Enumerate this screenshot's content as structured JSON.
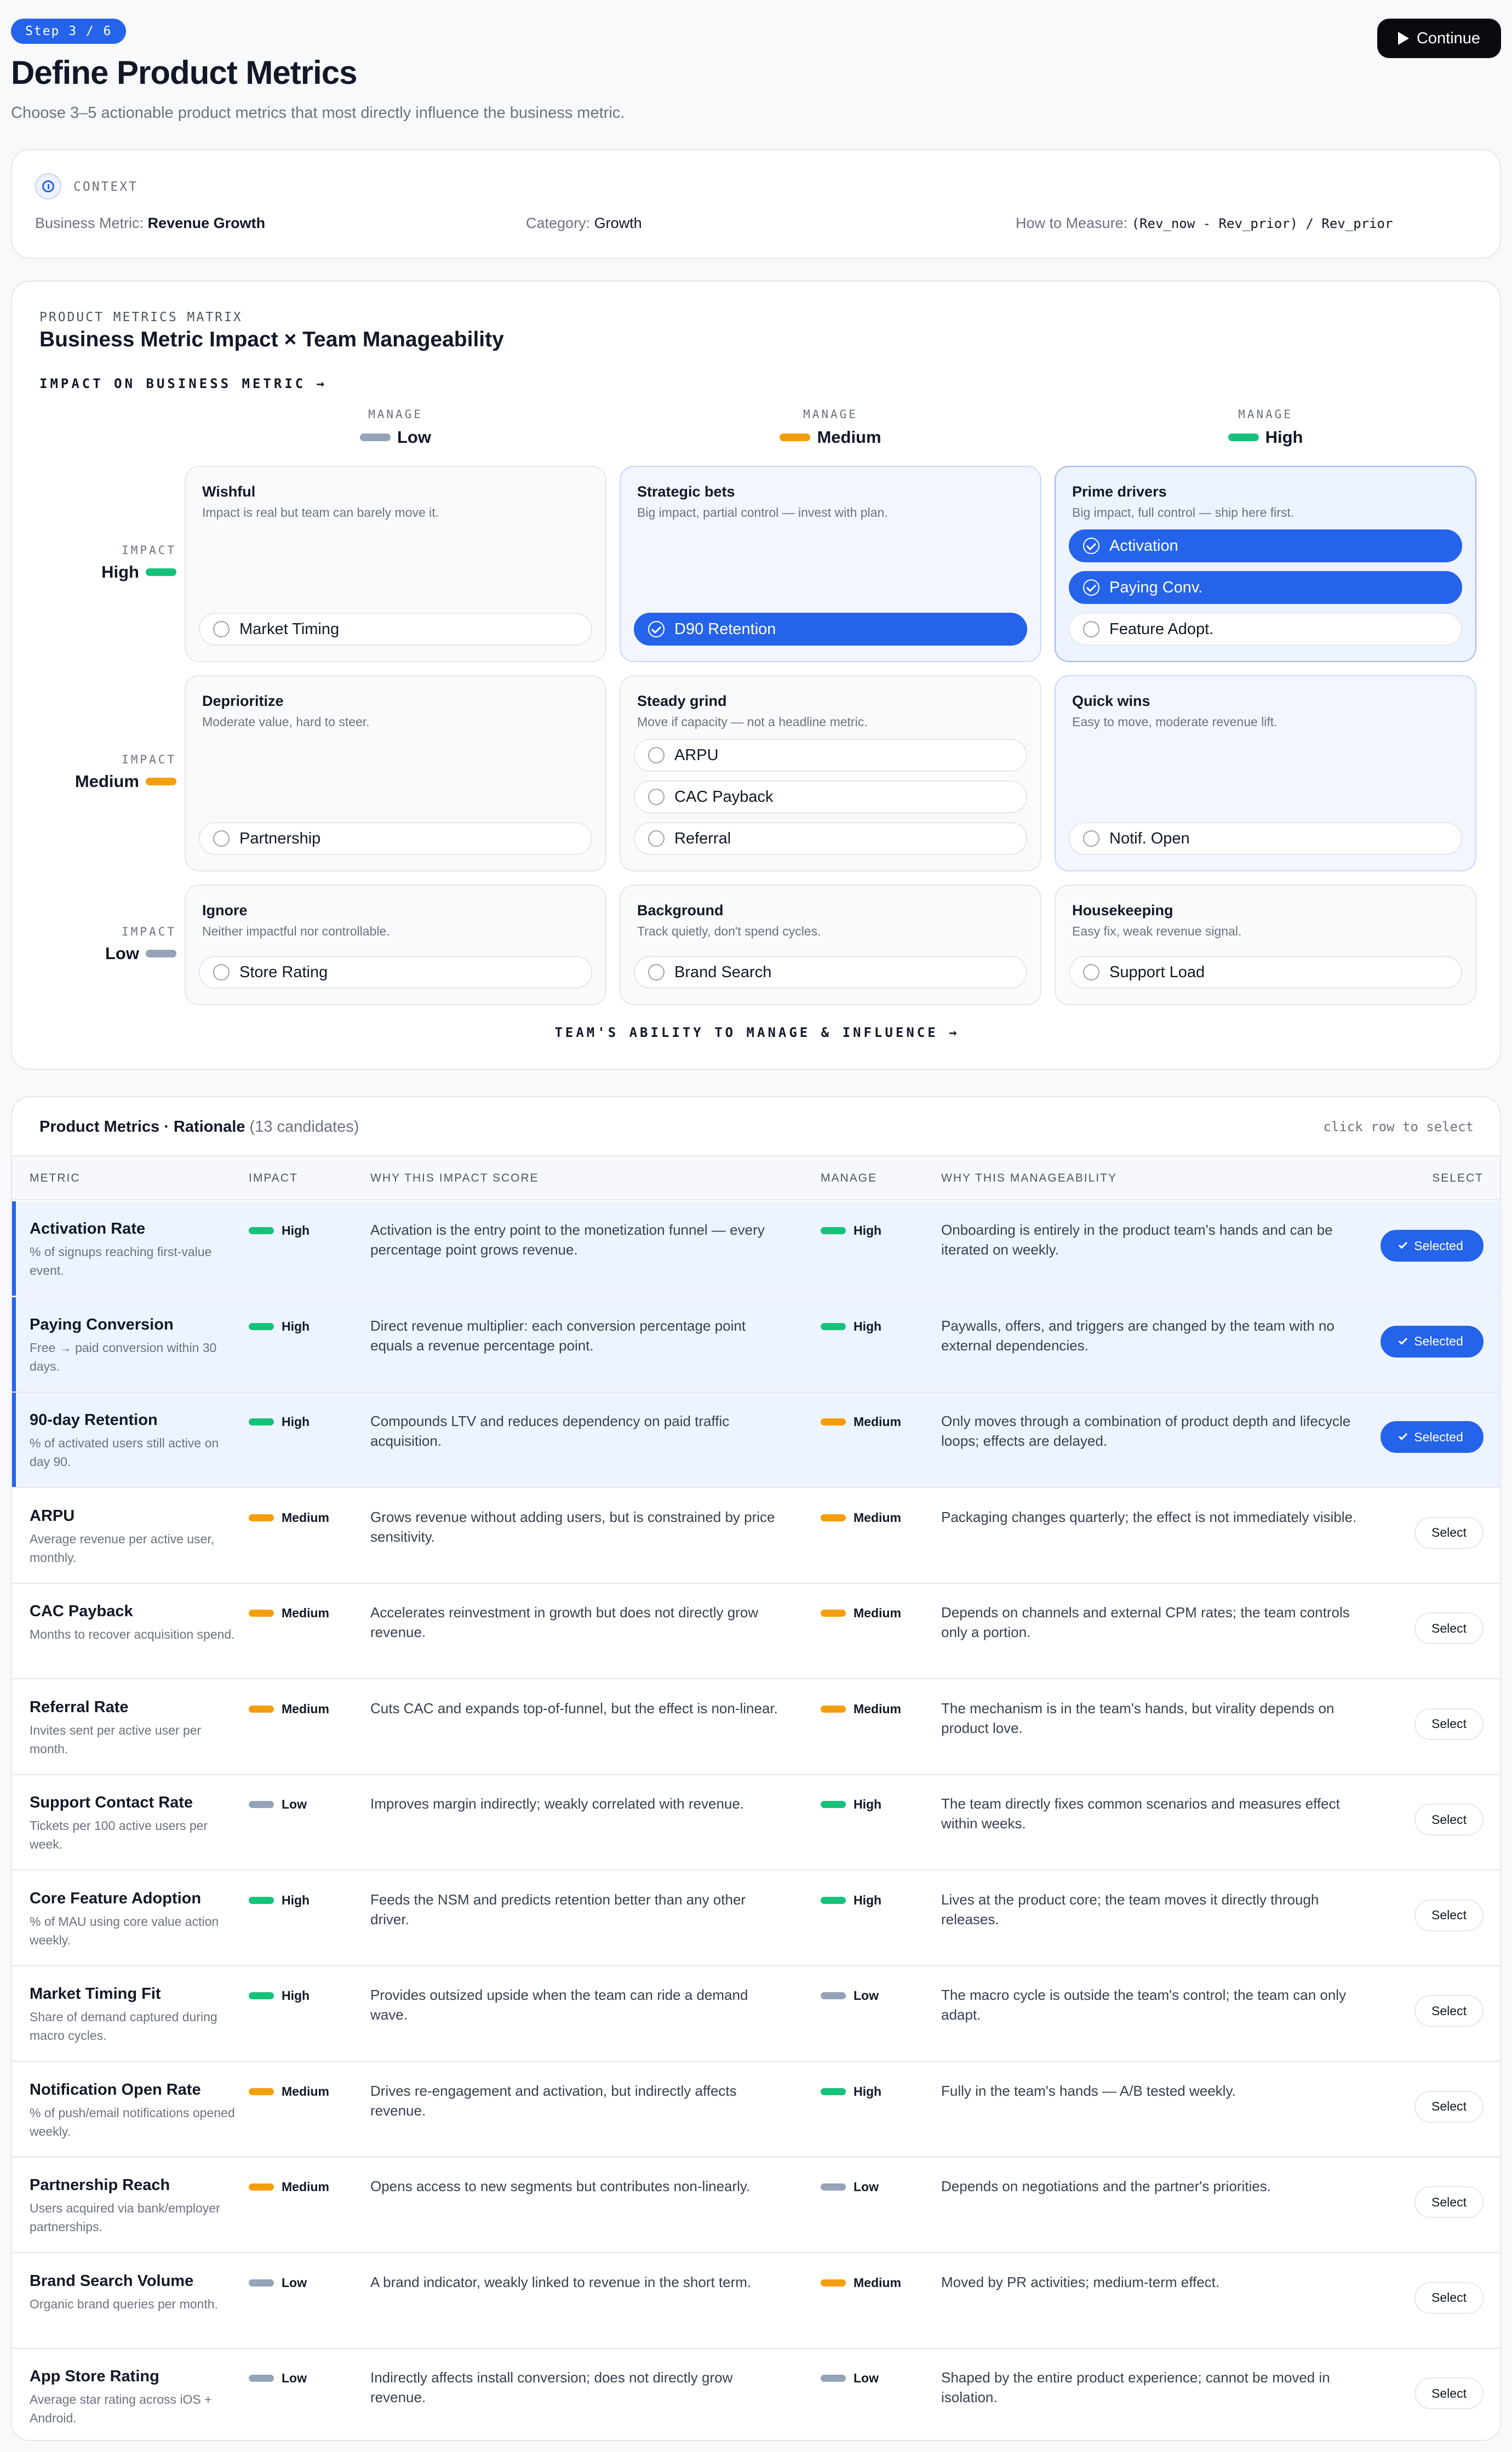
{
  "colors": {
    "high": "#16c27a",
    "medium": "#f59e0b",
    "low": "#94a3b8",
    "accent": "#2563eb"
  },
  "header": {
    "step": "Step 3 / 6",
    "title": "Define Product Metrics",
    "subtitle": "Choose 3–5 actionable product metrics that most directly influence the business metric.",
    "continue_label": "Continue"
  },
  "context": {
    "label": "CONTEXT",
    "business_metric_key": "Business Metric:",
    "business_metric": "Revenue Growth",
    "category_key": "Category:",
    "category": "Growth",
    "measure_key": "How to Measure:",
    "measure": "(Rev_now - Rev_prior) / Rev_prior"
  },
  "matrix": {
    "eyebrow": "PRODUCT METRICS MATRIX",
    "title": "Business Metric Impact × Team Manageability",
    "y_axis": "IMPACT ON BUSINESS METRIC →",
    "x_axis": "TEAM'S ABILITY TO MANAGE & INFLUENCE →",
    "col_key": "MANAGE",
    "row_key": "IMPACT",
    "levels": {
      "low": "Low",
      "medium": "Medium",
      "high": "High"
    },
    "cells": {
      "high_low": {
        "title": "Wishful",
        "sub": "Impact is real but team can barely move it.",
        "chips": [
          "Market Timing"
        ]
      },
      "high_medium": {
        "title": "Strategic bets",
        "sub": "Big impact, partial control — invest with plan.",
        "chips": [
          "D90 Retention"
        ]
      },
      "high_high": {
        "title": "Prime drivers",
        "sub": "Big impact, full control — ship here first.",
        "chips": [
          "Activation",
          "Paying Conv.",
          "Feature Adopt."
        ]
      },
      "medium_low": {
        "title": "Deprioritize",
        "sub": "Moderate value, hard to steer.",
        "chips": [
          "Partnership"
        ]
      },
      "medium_medium": {
        "title": "Steady grind",
        "sub": "Move if capacity — not a headline metric.",
        "chips": [
          "ARPU",
          "CAC Payback",
          "Referral"
        ]
      },
      "medium_high": {
        "title": "Quick wins",
        "sub": "Easy to move, moderate revenue lift.",
        "chips": [
          "Notif. Open"
        ]
      },
      "low_low": {
        "title": "Ignore",
        "sub": "Neither impactful nor controllable.",
        "chips": [
          "Store Rating"
        ]
      },
      "low_medium": {
        "title": "Background",
        "sub": "Track quietly, don't spend cycles.",
        "chips": [
          "Brand Search"
        ]
      },
      "low_high": {
        "title": "Housekeeping",
        "sub": "Easy fix, weak revenue signal.",
        "chips": [
          "Support Load"
        ]
      }
    }
  },
  "table": {
    "title": "Product Metrics · Rationale",
    "count": "(13 candidates)",
    "hint": "click row to select",
    "columns": {
      "metric": "METRIC",
      "impact": "IMPACT",
      "why_impact": "WHY THIS IMPACT SCORE",
      "manage": "MANAGE",
      "why_manage": "WHY THIS MANAGEABILITY",
      "select": "SELECT"
    },
    "selected_label": "Selected",
    "select_label": "Select",
    "rows": [
      {
        "name": "Activation Rate",
        "desc": "% of signups reaching first-value event.",
        "impact": "High",
        "why_impact": "Activation is the entry point to the monetization funnel — every percentage point grows revenue.",
        "manage": "High",
        "why_manage": "Onboarding is entirely in the product team's hands and can be iterated on weekly.",
        "selected": true
      },
      {
        "name": "Paying Conversion",
        "desc": "Free → paid conversion within 30 days.",
        "impact": "High",
        "why_impact": "Direct revenue multiplier: each conversion percentage point equals a revenue percentage point.",
        "manage": "High",
        "why_manage": "Paywalls, offers, and triggers are changed by the team with no external dependencies.",
        "selected": true
      },
      {
        "name": "90-day Retention",
        "desc": "% of activated users still active on day 90.",
        "impact": "High",
        "why_impact": "Compounds LTV and reduces dependency on paid traffic acquisition.",
        "manage": "Medium",
        "why_manage": "Only moves through a combination of product depth and lifecycle loops; effects are delayed.",
        "selected": true
      },
      {
        "name": "ARPU",
        "desc": "Average revenue per active user, monthly.",
        "impact": "Medium",
        "why_impact": "Grows revenue without adding users, but is constrained by price sensitivity.",
        "manage": "Medium",
        "why_manage": "Packaging changes quarterly; the effect is not immediately visible.",
        "selected": false
      },
      {
        "name": "CAC Payback",
        "desc": "Months to recover acquisition spend.",
        "impact": "Medium",
        "why_impact": "Accelerates reinvestment in growth but does not directly grow revenue.",
        "manage": "Medium",
        "why_manage": "Depends on channels and external CPM rates; the team controls only a portion.",
        "selected": false
      },
      {
        "name": "Referral Rate",
        "desc": "Invites sent per active user per month.",
        "impact": "Medium",
        "why_impact": "Cuts CAC and expands top-of-funnel, but the effect is non-linear.",
        "manage": "Medium",
        "why_manage": "The mechanism is in the team's hands, but virality depends on product love.",
        "selected": false
      },
      {
        "name": "Support Contact Rate",
        "desc": "Tickets per 100 active users per week.",
        "impact": "Low",
        "why_impact": "Improves margin indirectly; weakly correlated with revenue.",
        "manage": "High",
        "why_manage": "The team directly fixes common scenarios and measures effect within weeks.",
        "selected": false
      },
      {
        "name": "Core Feature Adoption",
        "desc": "% of MAU using core value action weekly.",
        "impact": "High",
        "why_impact": "Feeds the NSM and predicts retention better than any other driver.",
        "manage": "High",
        "why_manage": "Lives at the product core; the team moves it directly through releases.",
        "selected": false
      },
      {
        "name": "Market Timing Fit",
        "desc": "Share of demand captured during macro cycles.",
        "impact": "High",
        "why_impact": "Provides outsized upside when the team can ride a demand wave.",
        "manage": "Low",
        "why_manage": "The macro cycle is outside the team's control; the team can only adapt.",
        "selected": false
      },
      {
        "name": "Notification Open Rate",
        "desc": "% of push/email notifications opened weekly.",
        "impact": "Medium",
        "why_impact": "Drives re-engagement and activation, but indirectly affects revenue.",
        "manage": "High",
        "why_manage": "Fully in the team's hands — A/B tested weekly.",
        "selected": false
      },
      {
        "name": "Partnership Reach",
        "desc": "Users acquired via bank/employer partnerships.",
        "impact": "Medium",
        "why_impact": "Opens access to new segments but contributes non-linearly.",
        "manage": "Low",
        "why_manage": "Depends on negotiations and the partner's priorities.",
        "selected": false
      },
      {
        "name": "Brand Search Volume",
        "desc": "Organic brand queries per month.",
        "impact": "Low",
        "why_impact": "A brand indicator, weakly linked to revenue in the short term.",
        "manage": "Medium",
        "why_manage": "Moved by PR activities; medium-term effect.",
        "selected": false
      },
      {
        "name": "App Store Rating",
        "desc": "Average star rating across iOS + Android.",
        "impact": "Low",
        "why_impact": "Indirectly affects install conversion; does not directly grow revenue.",
        "manage": "Low",
        "why_manage": "Shaped by the entire product experience; cannot be moved in isolation.",
        "selected": false
      }
    ]
  }
}
